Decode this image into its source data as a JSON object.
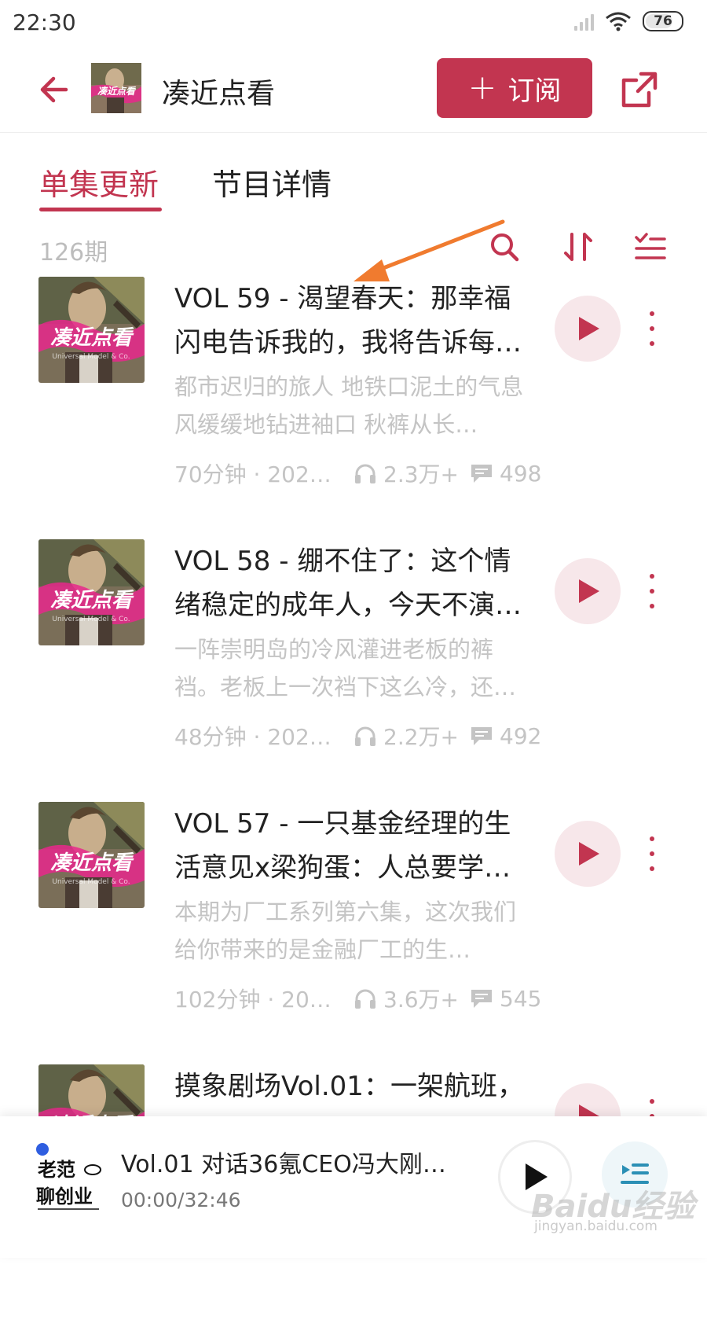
{
  "status_bar": {
    "time": "22:30",
    "battery": "76"
  },
  "header": {
    "title": "凑近点看",
    "subscribe_label": "订阅",
    "cover_text": "凑近点看"
  },
  "tabs": [
    {
      "label": "单集更新"
    },
    {
      "label": "节目详情"
    }
  ],
  "list": {
    "count": "126期"
  },
  "episodes": [
    {
      "title": "VOL 59 - 渴望春天：那幸福闪电告诉我的，我将告诉每…",
      "desc": "都市迟归的旅人 地铁口泥土的气息 风缓缓地钻进袖口 秋裤从长…",
      "duration": "70分钟 · 2022...",
      "plays": "2.3万+",
      "comments": "498",
      "cover_text": "凑近点看",
      "cover_sub": "Universal Model & Co."
    },
    {
      "title": "VOL 58 - 绷不住了：这个情绪稳定的成年人，今天不演…",
      "desc": "一阵崇明岛的冷风灌进老板的裤裆。老板上一次裆下这么冷，还…",
      "duration": "48分钟 · 2022...",
      "plays": "2.2万+",
      "comments": "492",
      "cover_text": "凑近点看",
      "cover_sub": "Universal Model & Co."
    },
    {
      "title": "VOL 57 - 一只基金经理的生活意见x梁狗蛋：人总要学…",
      "desc": "本期为厂工系列第六集，这次我们给你带来的是金融厂工的生…",
      "duration": "102分钟 · 202...",
      "plays": "3.6万+",
      "comments": "545",
      "cover_text": "凑近点看",
      "cover_sub": "Universal Model & Co."
    },
    {
      "title": "摸象剧场Vol.01：一架航班，",
      "desc": "",
      "duration": "",
      "plays": "",
      "comments": "",
      "cover_text": "凑近点看",
      "cover_sub": ""
    }
  ],
  "player": {
    "title": "Vol.01 对话36氪CEO冯大刚：…",
    "time": "00:00/32:46",
    "cover_line1": "老范",
    "cover_line2": "聊创业"
  },
  "watermark": {
    "brand": "Baidu经验",
    "url": "jingyan.baidu.com"
  },
  "colors": {
    "accent": "#c23550",
    "annotation_arrow": "#f07b2f"
  },
  "icons": {
    "back": "arrow-left-icon",
    "share": "share-icon",
    "search": "search-icon",
    "sort": "sort-icon",
    "filter": "checklist-icon",
    "headphones": "headphones-icon",
    "comment": "comment-icon",
    "play": "play-icon",
    "more": "more-vertical-icon",
    "playlist": "playlist-icon"
  }
}
